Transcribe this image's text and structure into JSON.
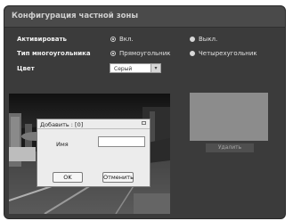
{
  "panel": {
    "title": "Конфигурация частной зоны"
  },
  "activate": {
    "label": "Активировать",
    "options": [
      {
        "label": "Вкл.",
        "selected": true
      },
      {
        "label": "Выкл.",
        "selected": false
      }
    ]
  },
  "polygon_type": {
    "label": "Тип многоугольника",
    "options": [
      {
        "label": "Прямоугольник",
        "selected": true
      },
      {
        "label": "Четырехугольник",
        "selected": false
      }
    ]
  },
  "color": {
    "label": "Цвет",
    "value": "Серый"
  },
  "preview": {
    "delete_label": "Удалить"
  },
  "dialog": {
    "title": "Добавить : [0]",
    "name_label": "Имя",
    "name_value": "",
    "ok_label": "OK",
    "cancel_label": "Отменить"
  },
  "colors": {
    "panel_bg": "#3b3b3b",
    "preview_box": "#8c8c8c",
    "dialog_bg": "#ececec"
  }
}
